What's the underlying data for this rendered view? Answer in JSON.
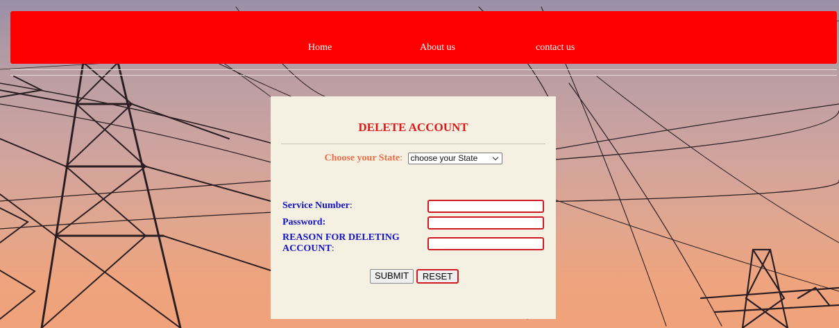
{
  "nav": {
    "items": [
      {
        "label": "Home"
      },
      {
        "label": "About us"
      },
      {
        "label": "contact us"
      }
    ]
  },
  "form": {
    "title": "DELETE ACCOUNT",
    "state": {
      "label": "Choose your State",
      "colon": ":",
      "selected": "choose your State"
    },
    "fields": {
      "service_number": {
        "label": "Service Number",
        "colon": ":",
        "value": ""
      },
      "password": {
        "label": "Password",
        "colon": ":",
        "value": ""
      },
      "reason": {
        "label_line1": "REASON FOR DELETING",
        "label_line2": "ACCOUNT",
        "colon": ":",
        "value": ""
      }
    },
    "buttons": {
      "submit": "SUBMIT",
      "reset": "RESET"
    }
  },
  "colors": {
    "header": "#ff0000",
    "panel": "#f4f0e2",
    "title": "#e01818",
    "state_label": "#e87048",
    "field_label": "#1414c8",
    "input_border": "#d01820"
  },
  "background": {
    "scene": "sunset-power-lines-image"
  }
}
